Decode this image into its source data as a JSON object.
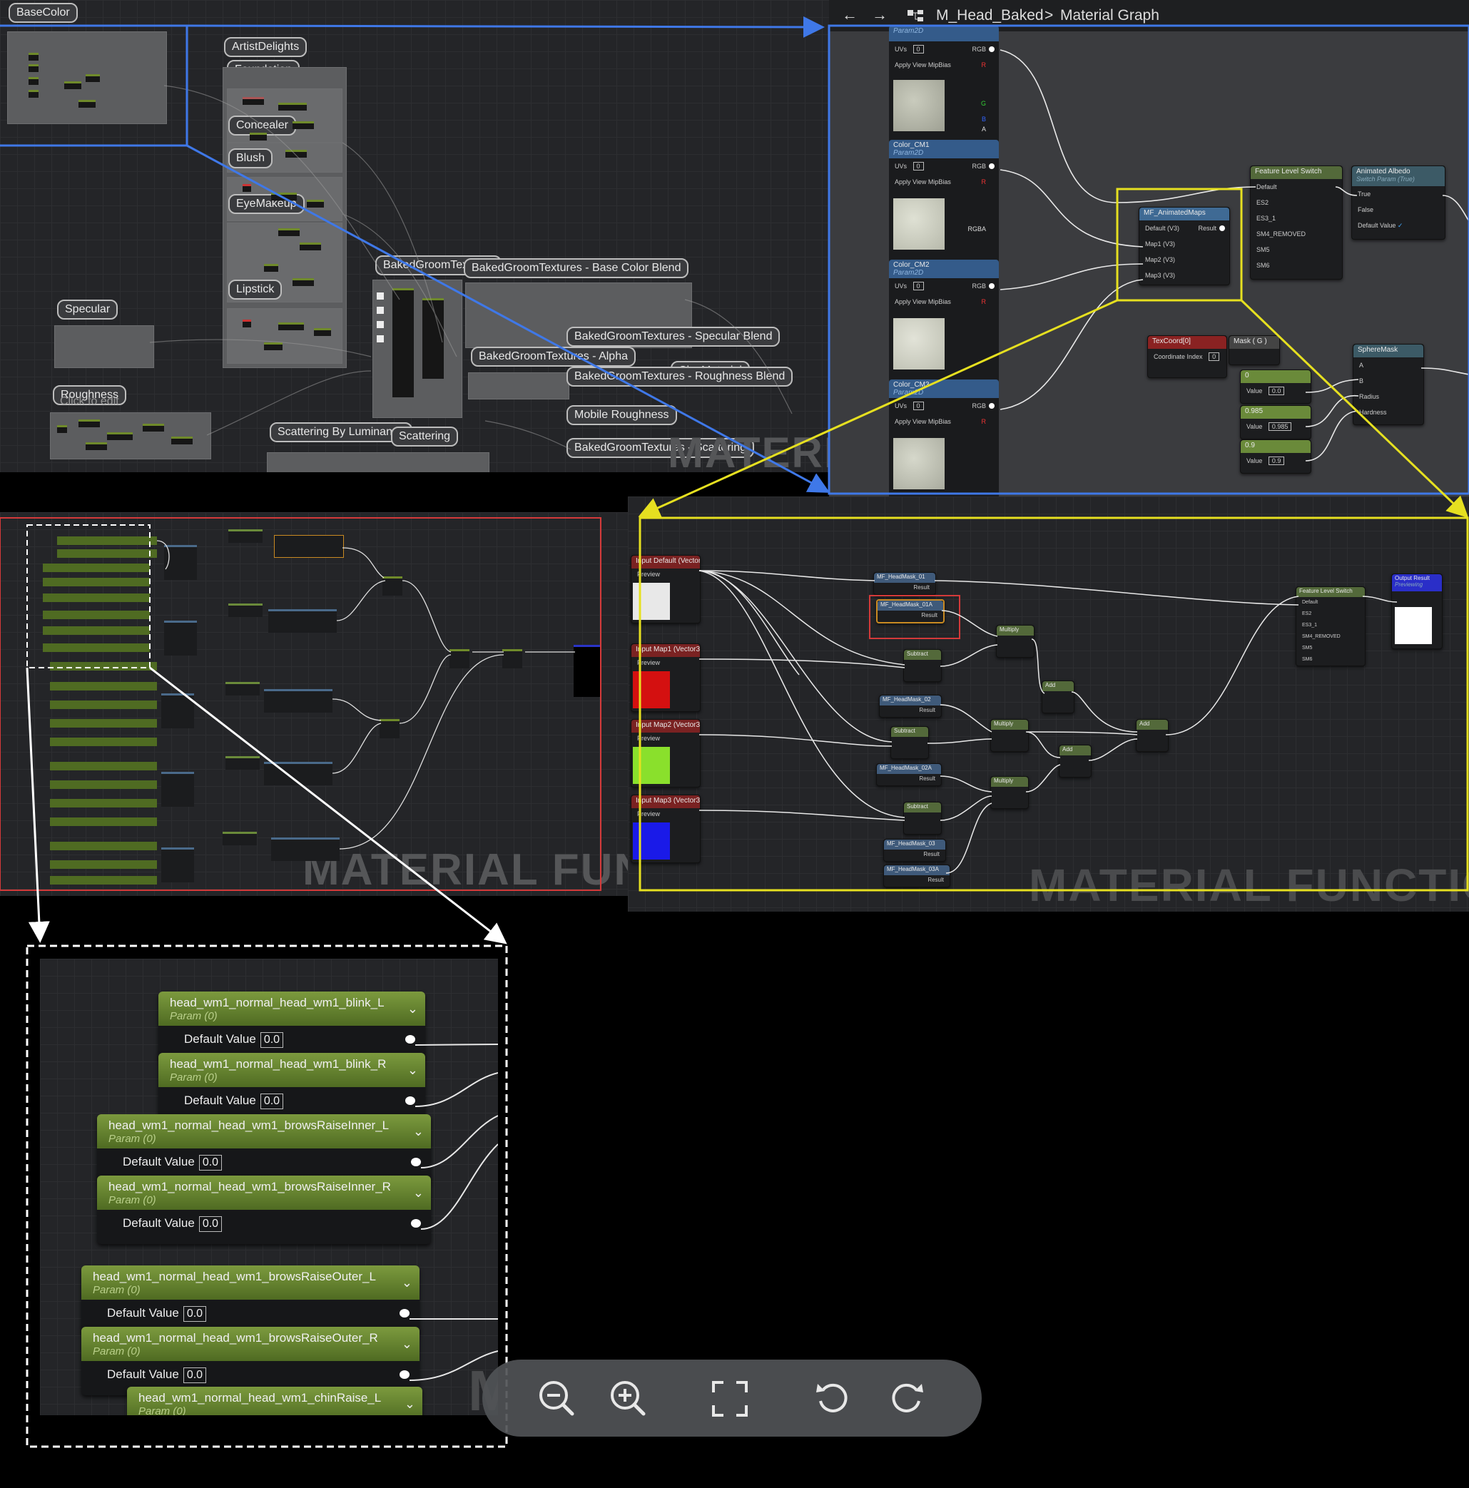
{
  "overview": {
    "labels": {
      "basecolor": "BaseColor",
      "artistdelights": "ArtistDelights",
      "foundation": "Foundation",
      "concealer": "Concealer",
      "blush": "Blush",
      "eyemakeup": "EyeMakeup",
      "lipstick": "Lipstick",
      "specular": "Specular",
      "roughness": "Roughness",
      "click_to_edit": "Click to edit",
      "baked_groom_textures": "BakedGroomTextures",
      "base_color_blend": "BakedGroomTextures - Base Color Blend",
      "specular_blend": "BakedGroomTextures - Specular Blend",
      "alpha": "BakedGroomTextures - Alpha",
      "clay_material": "ClayMaterial",
      "roughness_blend": "BakedGroomTextures - Roughness Blend",
      "mobile_roughness": "Mobile Roughness",
      "scattering_btex": "BakedGroomTextures - Scattering",
      "scattering_by_luminance": "Scattering By Luminance",
      "scattering": "Scattering"
    },
    "watermark": "MATERIAL"
  },
  "graph_detail": {
    "breadcrumb": {
      "asset": "M_Head_Baked",
      "separator": ">",
      "graph": "Material Graph"
    },
    "texture_params": [
      {
        "name": "",
        "type": "Param2D"
      },
      {
        "name": "Color_CM1",
        "type": "Param2D"
      },
      {
        "name": "Color_CM2",
        "type": "Param2D"
      },
      {
        "name": "Color_CM3",
        "type": "Param2D"
      }
    ],
    "texture_rows": {
      "uvs": "UVs",
      "uvs_value": "0",
      "mip": "Apply View MipBias",
      "rgb": "RGB",
      "r": "R",
      "g": "G",
      "b": "B",
      "a": "A",
      "rgba": "RGBA"
    },
    "animated_maps": {
      "title": "MF_AnimatedMaps",
      "inputs": [
        "Default (V3)",
        "Map1 (V3)",
        "Map2 (V3)",
        "Map3 (V3)"
      ],
      "output": "Result"
    },
    "feature_switch": {
      "title": "Feature Level Switch",
      "inputs": [
        "Default",
        "ES2",
        "ES3_1",
        "SM4_REMOVED",
        "SM5",
        "SM6"
      ]
    },
    "animated_albedo": {
      "title": "Animated Albedo",
      "subtitle": "Switch Param (True)",
      "inputs": [
        "True",
        "False"
      ],
      "default_label": "Default Value",
      "check": "✓"
    },
    "texcoord": {
      "title": "TexCoord[0]",
      "row": "Coordinate Index",
      "value": "0"
    },
    "mask": {
      "title": "Mask ( G )"
    },
    "const1": {
      "title": "0",
      "label": "Value",
      "value": "0.0"
    },
    "const2": {
      "title": "0.985",
      "label": "Value",
      "value": "0.985"
    },
    "const3": {
      "title": "0.9",
      "label": "Value",
      "value": "0.9"
    },
    "spheremask": {
      "title": "SphereMask",
      "inputs": [
        "A",
        "B",
        "Radius",
        "Hardness"
      ]
    }
  },
  "function_left": {
    "watermark": "MATERIAL FUNCT"
  },
  "function_right": {
    "watermark": "MATERIAL FUNCTION",
    "inputs": [
      {
        "title": "Input Default (Vector3)",
        "preview": "Preview",
        "color": "#e8e8e8"
      },
      {
        "title": "Input Map1 (Vector3)",
        "preview": "Preview",
        "color": "#d41010"
      },
      {
        "title": "Input Map2 (Vector3)",
        "preview": "Preview",
        "color": "#8ae02c"
      },
      {
        "title": "Input Map3 (Vector3)",
        "preview": "Preview",
        "color": "#1a1ae8"
      }
    ],
    "masks": [
      "MF_HeadMask_01",
      "MF_HeadMask_01A",
      "MF_HeadMask_02",
      "MF_HeadMask_02A",
      "MF_HeadMask_03",
      "MF_HeadMask_03A"
    ],
    "mask_output": "Result",
    "ops": {
      "subtract": "Subtract",
      "multiply": "Multiply",
      "add": "Add",
      "a": "A",
      "b": "B"
    },
    "feature_switch": {
      "title": "Feature Level Switch",
      "inputs": [
        "Default",
        "ES2",
        "ES3_1",
        "SM4_REMOVED",
        "SM5",
        "SM6"
      ]
    },
    "output": {
      "title": "Output Result",
      "sub": "Previewing"
    }
  },
  "zoom_params": [
    {
      "name": "head_wm1_normal_head_wm1_blink_L",
      "type": "Param (0)",
      "default_label": "Default Value",
      "value": "0.0"
    },
    {
      "name": "head_wm1_normal_head_wm1_blink_R",
      "type": "Param (0)",
      "default_label": "Default Value",
      "value": "0.0"
    },
    {
      "name": "head_wm1_normal_head_wm1_browsRaiseInner_L",
      "type": "Param (0)",
      "default_label": "Default Value",
      "value": "0.0"
    },
    {
      "name": "head_wm1_normal_head_wm1_browsRaiseInner_R",
      "type": "Param (0)",
      "default_label": "Default Value",
      "value": "0.0"
    },
    {
      "name": "head_wm1_normal_head_wm1_browsRaiseOuter_L",
      "type": "Param (0)",
      "default_label": "Default Value",
      "value": "0.0"
    },
    {
      "name": "head_wm1_normal_head_wm1_browsRaiseOuter_R",
      "type": "Param (0)",
      "default_label": "Default Value",
      "value": "0.0"
    },
    {
      "name": "head_wm1_normal_head_wm1_chinRaise_L",
      "type": "Param (0)",
      "default_label": "",
      "value": ""
    }
  ],
  "toolbar": {
    "zoom_out": "zoom-out-icon",
    "zoom_in": "zoom-in-icon",
    "fit": "fit-screen-icon",
    "rotate_left": "rotate-left-icon",
    "rotate_right": "rotate-right-icon"
  },
  "colors": {
    "blue_callout": "#3f78e8",
    "yellow_callout": "#e6e020",
    "red_frame": "#d43a3a",
    "param_green": "#6d8a32"
  }
}
